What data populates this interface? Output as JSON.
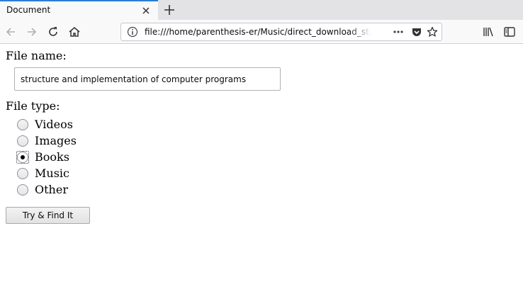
{
  "browser": {
    "tab": {
      "title": "Document"
    },
    "address_bar": {
      "url": "file:///home/parenthesis-er/Music/direct_download_stalker.html"
    },
    "icons": {
      "tab_close": "close-icon",
      "new_tab": "plus-icon",
      "back": "back-arrow-icon",
      "forward": "forward-arrow-icon",
      "reload": "reload-icon",
      "home": "home-icon",
      "site_info": "info-icon",
      "page_actions": "more-dots-icon",
      "pocket": "pocket-icon",
      "bookmark": "star-icon",
      "library": "library-icon",
      "sidebar": "sidebar-icon"
    },
    "accent_color": "#0a84ff"
  },
  "form": {
    "file_name_label": "File name:",
    "file_name_value": "structure and implementation of computer programs",
    "file_type_label": "File type:",
    "file_types": [
      {
        "label": "Videos",
        "checked": false
      },
      {
        "label": "Images",
        "checked": false
      },
      {
        "label": "Books",
        "checked": true
      },
      {
        "label": "Music",
        "checked": false
      },
      {
        "label": "Other",
        "checked": false
      }
    ],
    "submit_label": "Try & Find It"
  }
}
